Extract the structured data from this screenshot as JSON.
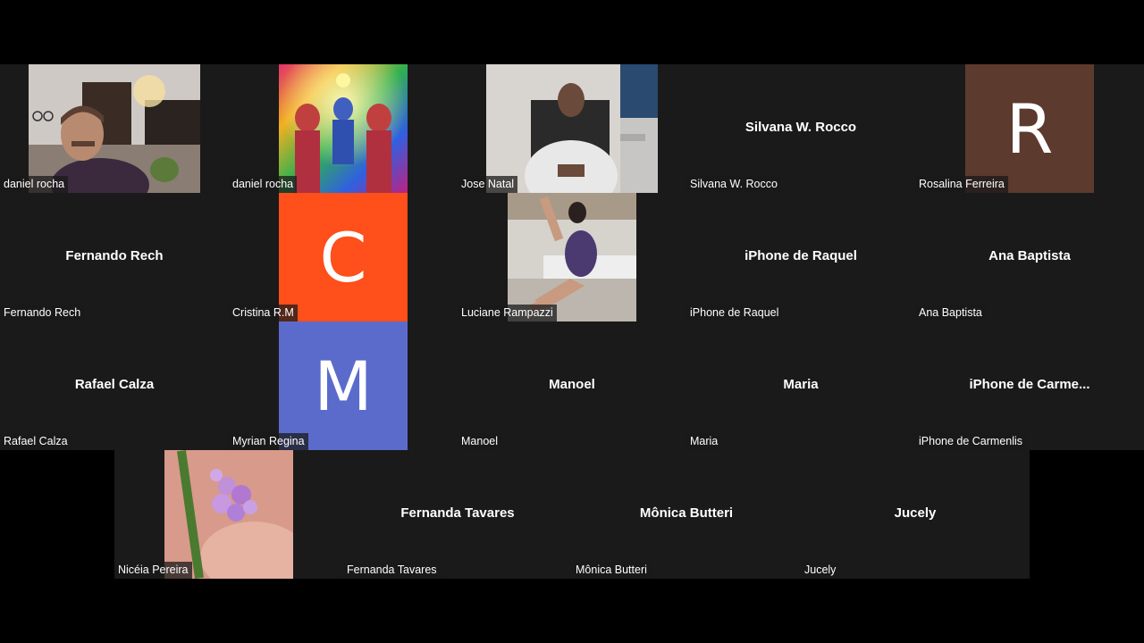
{
  "participants": [
    {
      "label": "daniel rocha",
      "display": "video"
    },
    {
      "label": "daniel rocha",
      "display": "image"
    },
    {
      "label": "Jose Natal",
      "display": "video"
    },
    {
      "label": "Silvana W. Rocco",
      "center_name": "Silvana W. Rocco",
      "display": "name"
    },
    {
      "label": "Rosalina Ferreira",
      "avatar_letter": "R",
      "avatar_color": "#5c3a2e",
      "display": "avatar"
    },
    {
      "label": "Fernando Rech",
      "center_name": "Fernando Rech",
      "display": "name"
    },
    {
      "label": "Cristina R.M",
      "avatar_letter": "C",
      "avatar_color": "#ff4f1a",
      "display": "avatar"
    },
    {
      "label": "Luciane Rampazzi",
      "display": "image"
    },
    {
      "label": "iPhone de Raquel",
      "center_name": "iPhone de Raquel",
      "display": "name"
    },
    {
      "label": "Ana Baptista",
      "center_name": "Ana Baptista",
      "display": "name"
    },
    {
      "label": "Rafael Calza",
      "center_name": "Rafael Calza",
      "display": "name"
    },
    {
      "label": "Myrian Regina",
      "avatar_letter": "M",
      "avatar_color": "#5b6bcc",
      "display": "avatar"
    },
    {
      "label": "Manoel",
      "center_name": "Manoel",
      "display": "name"
    },
    {
      "label": "Maria",
      "center_name": "Maria",
      "display": "name"
    },
    {
      "label": "iPhone de Carmenlis",
      "center_name": "iPhone de Carme...",
      "display": "name"
    },
    {
      "label": "Nicéia Pereira",
      "display": "image"
    },
    {
      "label": "Fernanda Tavares",
      "center_name": "Fernanda Tavares",
      "display": "name"
    },
    {
      "label": "Mônica Butteri",
      "center_name": "Mônica Butteri",
      "display": "name"
    },
    {
      "label": "Jucely",
      "center_name": "Jucely",
      "display": "name"
    }
  ]
}
